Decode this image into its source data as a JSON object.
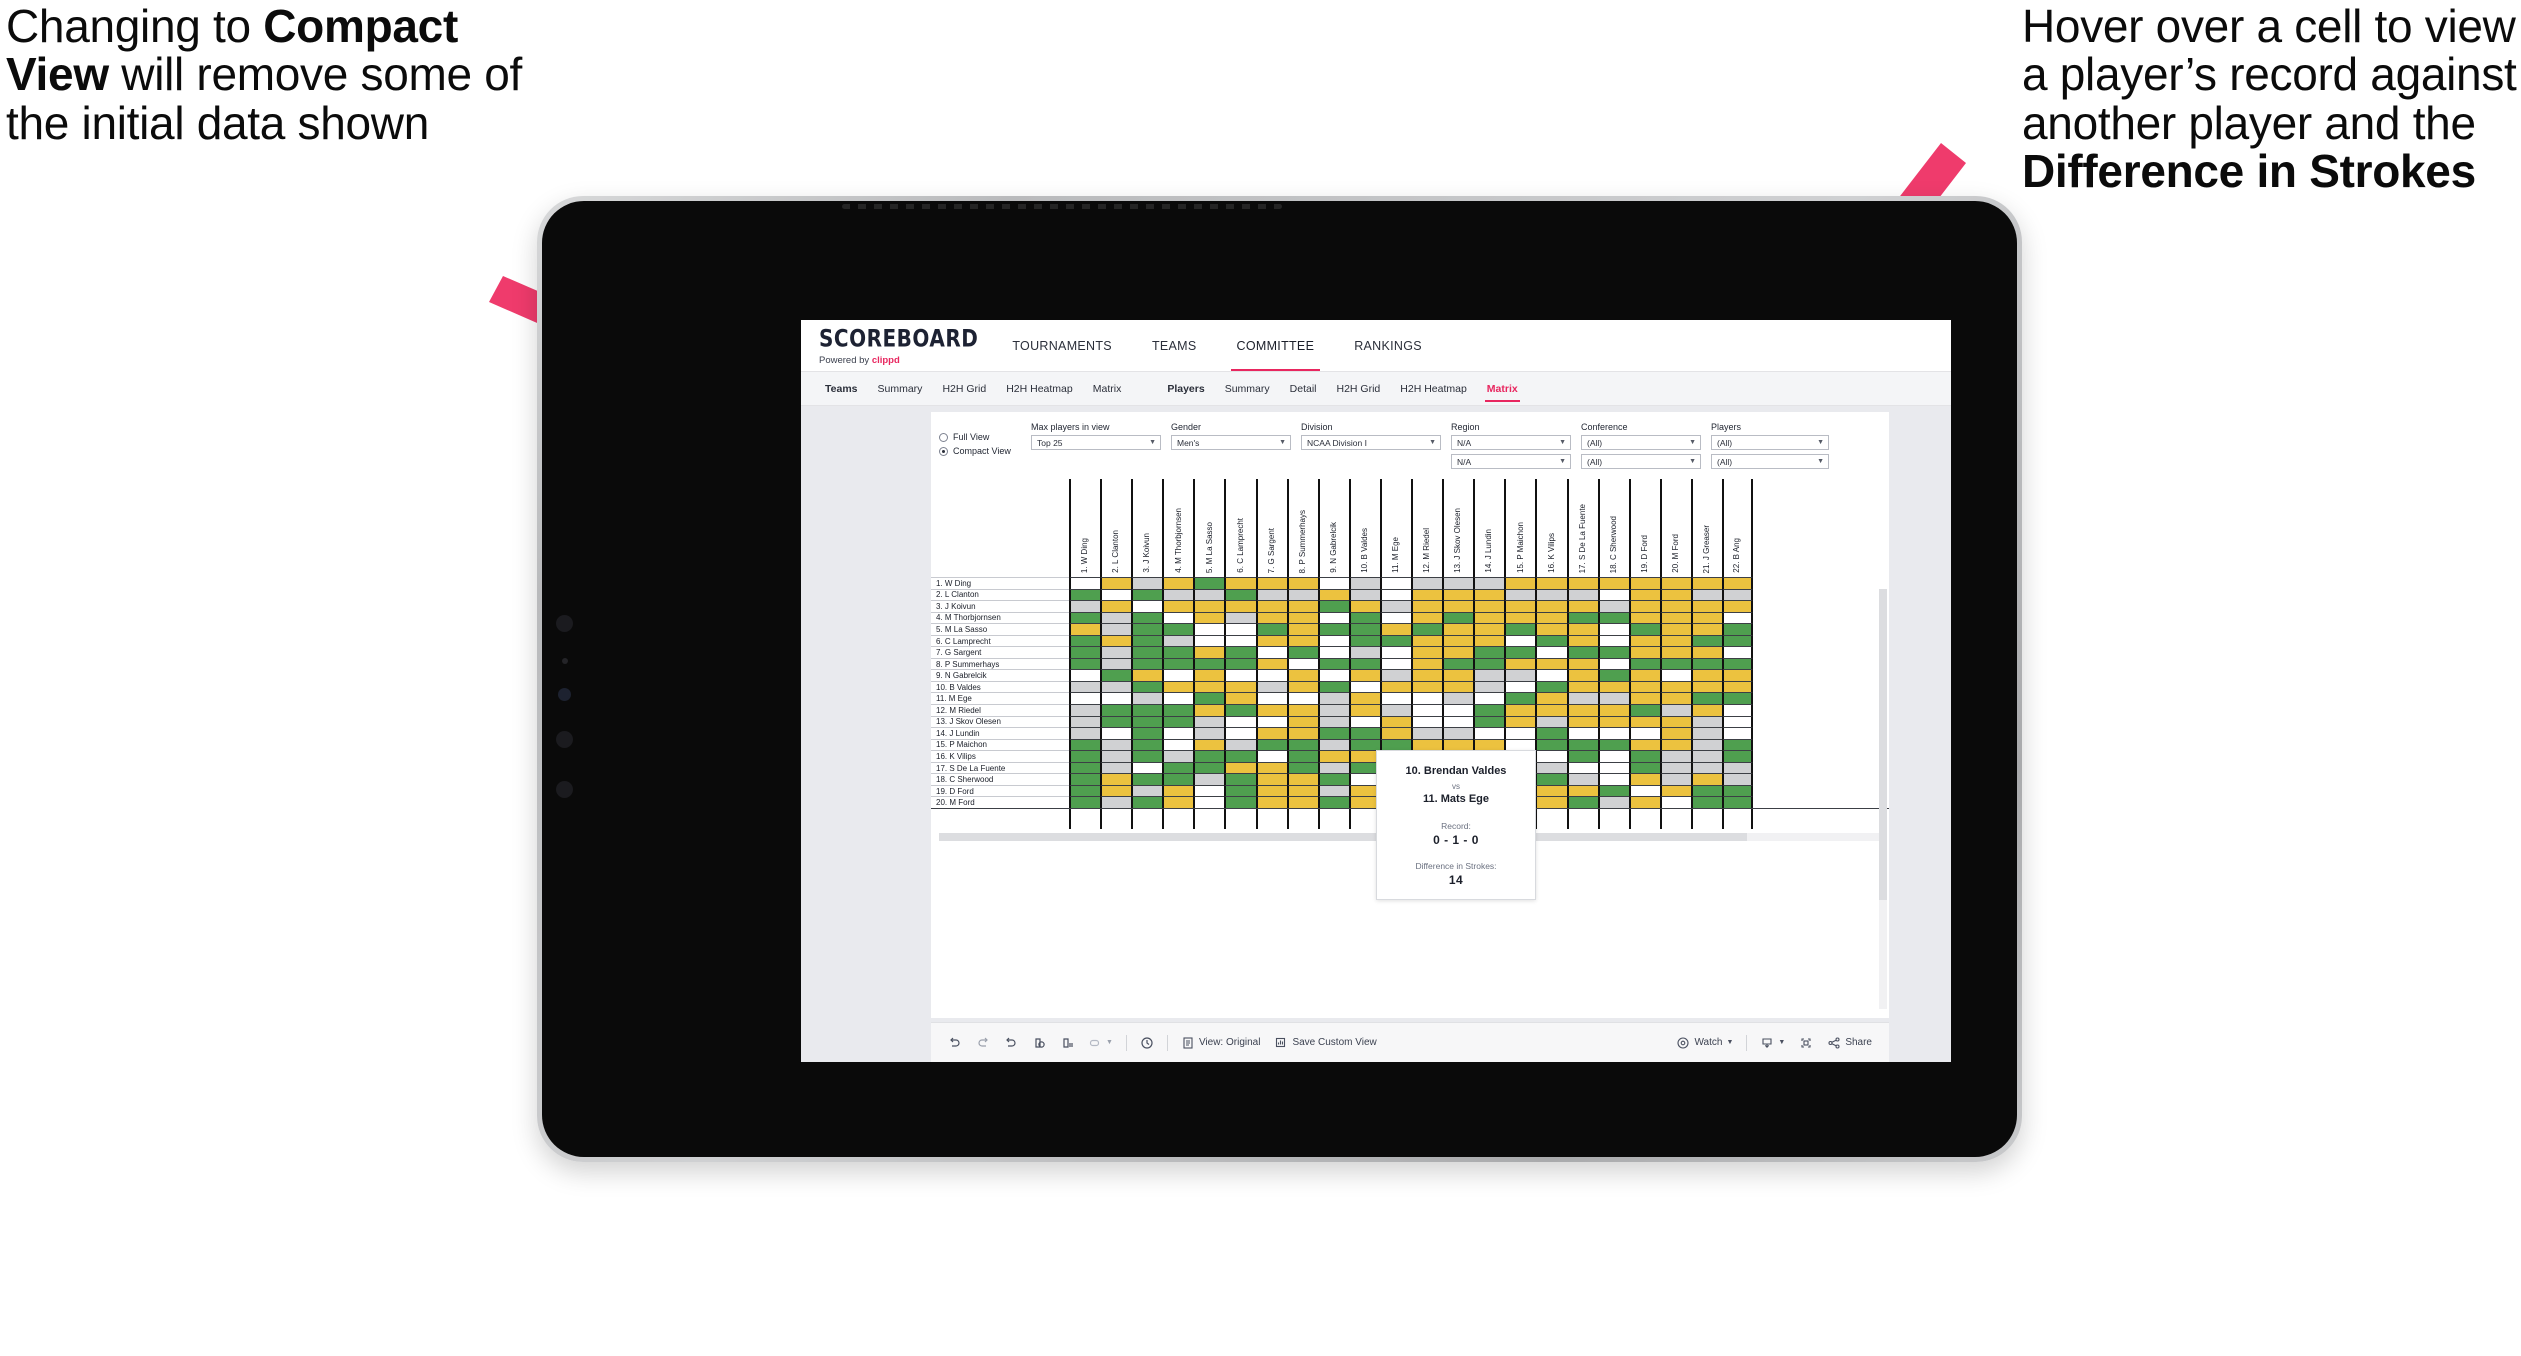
{
  "annotations": {
    "left": {
      "line1": "Changing to",
      "bold1": "Compact View",
      "line2": " will remove some of the initial data shown"
    },
    "right": {
      "line1": "Hover over a cell to view a player’s record against another player and the ",
      "bold1": "Difference in Strokes"
    },
    "arrow_color": "#ef3b6c"
  },
  "app": {
    "brand": {
      "name": "SCOREBOARD",
      "sub_prefix": "Powered by ",
      "sub_brand": "clippd"
    },
    "top_tabs": [
      {
        "label": "TOURNAMENTS",
        "active": false
      },
      {
        "label": "TEAMS",
        "active": false
      },
      {
        "label": "COMMITTEE",
        "active": true
      },
      {
        "label": "RANKINGS",
        "active": false
      }
    ],
    "sub_nav": {
      "group_teams": {
        "head": "Teams",
        "items": [
          "Summary",
          "H2H Grid",
          "H2H Heatmap",
          "Matrix"
        ]
      },
      "group_players": {
        "head": "Players",
        "items": [
          "Summary",
          "Detail",
          "H2H Grid",
          "H2H Heatmap",
          "Matrix"
        ],
        "active": "Matrix"
      }
    },
    "filters": {
      "view_options": [
        {
          "label": "Full View",
          "selected": false
        },
        {
          "label": "Compact View",
          "selected": true
        }
      ],
      "selects": [
        {
          "label": "Max players in view",
          "value": "Top 25"
        },
        {
          "label": "Gender",
          "value": "Men's"
        },
        {
          "label": "Division",
          "value": "NCAA Division I"
        },
        {
          "label": "Region",
          "value": "N/A",
          "value2": "N/A"
        },
        {
          "label": "Conference",
          "value": "(All)",
          "value2": "(All)"
        },
        {
          "label": "Players",
          "value": "(All)",
          "value2": "(All)"
        }
      ]
    },
    "tooltip": {
      "player_a": "10. Brendan Valdes",
      "vs": "vs",
      "player_b": "11. Mats Ege",
      "record_label": "Record:",
      "record_value": "0 - 1 - 0",
      "strokes_label": "Difference in Strokes:",
      "strokes_value": "14"
    },
    "bottom_toolbar": {
      "icons_left": [
        "undo-icon",
        "redo-icon",
        "revert-icon",
        "refresh-data-icon",
        "pause-refresh-icon",
        "keep-shape-icon",
        "chevron-down-icon"
      ],
      "clock_icon": "history-icon",
      "view_original": "View: Original",
      "view_original_icon": "view-original-icon",
      "save_custom_view": "Save Custom View",
      "save_custom_view_icon": "save-view-icon",
      "watch": "Watch",
      "watch_icon": "eye-icon",
      "download_icon": "download-icon",
      "fullscreen_icon": "fullscreen-icon",
      "share": "Share",
      "share_icon": "share-icon"
    }
  },
  "chart_data": {
    "type": "heatmap",
    "title": "Head-to-head player matrix",
    "legend": {
      "win": "#4f9f4f",
      "loss": "#ecc23f",
      "tie": "#d0d1d3",
      "none": "#ffffff"
    },
    "colors": {
      "green": "#4f9f4f",
      "yellow": "#ecc23f",
      "grey": "#d0d1d3",
      "white": "#ffffff"
    },
    "columns": [
      "1. W Ding",
      "2. L Clanton",
      "3. J Koivun",
      "4. M Thorbjornsen",
      "5. M La Sasso",
      "6. C Lamprecht",
      "7. G Sargent",
      "8. P Summerhays",
      "9. N Gabrelcik",
      "10. B Valdes",
      "11. M Ege",
      "12. M Riedel",
      "13. J Skov Olesen",
      "14. J Lundin",
      "15. P Maichon",
      "16. K Vilips",
      "17. S De La Fuente",
      "18. C Sherwood",
      "19. D Ford",
      "20. M Ford",
      "21. J Greaser",
      "22. B Ang"
    ],
    "rows": [
      "1. W Ding",
      "2. L Clanton",
      "3. J Koivun",
      "4. M Thorbjornsen",
      "5. M La Sasso",
      "6. C Lamprecht",
      "7. G Sargent",
      "8. P Summerhays",
      "9. N Gabrelcik",
      "10. B Valdes",
      "11. M Ege",
      "12. M Riedel",
      "13. J Skov Olesen",
      "14. J Lundin",
      "15. P Maichon",
      "16. K Vilips",
      "17. S De La Fuente",
      "18. C Sherwood",
      "19. D Ford",
      "20. M Ford"
    ],
    "cells": [
      [
        "w",
        "y",
        "g",
        "y",
        "n",
        "y",
        "y",
        "y",
        "w",
        "g",
        "w",
        "g",
        "g",
        "g",
        "y",
        "y",
        "y",
        "y",
        "y",
        "y",
        "y",
        "y"
      ],
      [
        "n",
        "w",
        "n",
        "g",
        "g",
        "n",
        "g",
        "g",
        "y",
        "g",
        "w",
        "y",
        "y",
        "y",
        "g",
        "g",
        "g",
        "w",
        "y",
        "y",
        "g",
        "g"
      ],
      [
        "g",
        "y",
        "w",
        "y",
        "y",
        "y",
        "y",
        "y",
        "n",
        "y",
        "g",
        "y",
        "y",
        "y",
        "y",
        "y",
        "y",
        "g",
        "y",
        "y",
        "y",
        "y"
      ],
      [
        "n",
        "g",
        "n",
        "w",
        "y",
        "g",
        "y",
        "y",
        "w",
        "n",
        "w",
        "y",
        "n",
        "y",
        "y",
        "y",
        "n",
        "n",
        "y",
        "y",
        "y",
        "w"
      ],
      [
        "y",
        "g",
        "n",
        "n",
        "w",
        "w",
        "n",
        "y",
        "n",
        "n",
        "y",
        "n",
        "y",
        "y",
        "n",
        "y",
        "y",
        "w",
        "n",
        "y",
        "y",
        "n"
      ],
      [
        "n",
        "y",
        "n",
        "g",
        "w",
        "w",
        "y",
        "y",
        "w",
        "n",
        "n",
        "y",
        "y",
        "y",
        "w",
        "n",
        "y",
        "w",
        "y",
        "y",
        "n",
        "n"
      ],
      [
        "n",
        "g",
        "n",
        "n",
        "y",
        "n",
        "w",
        "n",
        "w",
        "g",
        "w",
        "y",
        "y",
        "n",
        "n",
        "w",
        "n",
        "n",
        "y",
        "y",
        "y",
        "w"
      ],
      [
        "n",
        "g",
        "n",
        "n",
        "n",
        "n",
        "y",
        "w",
        "n",
        "n",
        "w",
        "y",
        "n",
        "n",
        "y",
        "y",
        "y",
        "w",
        "n",
        "n",
        "n",
        "n"
      ],
      [
        "w",
        "n",
        "y",
        "w",
        "y",
        "w",
        "w",
        "y",
        "w",
        "y",
        "g",
        "y",
        "y",
        "g",
        "g",
        "w",
        "y",
        "n",
        "y",
        "w",
        "y",
        "y"
      ],
      [
        "g",
        "g",
        "n",
        "y",
        "y",
        "y",
        "g",
        "y",
        "n",
        "w",
        "y",
        "y",
        "y",
        "g",
        "w",
        "n",
        "y",
        "y",
        "y",
        "y",
        "y",
        "y"
      ],
      [
        "w",
        "w",
        "g",
        "w",
        "n",
        "y",
        "w",
        "w",
        "g",
        "y",
        "w",
        "w",
        "g",
        "w",
        "n",
        "y",
        "g",
        "g",
        "y",
        "y",
        "n",
        "n"
      ],
      [
        "g",
        "n",
        "n",
        "n",
        "y",
        "n",
        "y",
        "y",
        "g",
        "y",
        "g",
        "w",
        "w",
        "n",
        "y",
        "y",
        "y",
        "y",
        "n",
        "g",
        "y",
        "w"
      ],
      [
        "g",
        "n",
        "n",
        "n",
        "g",
        "w",
        "w",
        "y",
        "g",
        "w",
        "y",
        "w",
        "w",
        "n",
        "y",
        "g",
        "y",
        "y",
        "y",
        "y",
        "g",
        "w"
      ],
      [
        "g",
        "w",
        "n",
        "w",
        "g",
        "w",
        "y",
        "y",
        "n",
        "n",
        "y",
        "g",
        "g",
        "w",
        "w",
        "n",
        "w",
        "w",
        "w",
        "y",
        "g",
        "w"
      ],
      [
        "n",
        "g",
        "n",
        "w",
        "y",
        "g",
        "n",
        "n",
        "g",
        "n",
        "n",
        "y",
        "y",
        "y",
        "w",
        "n",
        "n",
        "n",
        "y",
        "y",
        "g",
        "n"
      ],
      [
        "n",
        "g",
        "n",
        "g",
        "n",
        "n",
        "w",
        "n",
        "y",
        "y",
        "y",
        "n",
        "y",
        "n",
        "g",
        "w",
        "n",
        "w",
        "n",
        "g",
        "g",
        "n"
      ],
      [
        "n",
        "g",
        "w",
        "n",
        "n",
        "y",
        "y",
        "n",
        "g",
        "n",
        "y",
        "n",
        "n",
        "y",
        "y",
        "g",
        "w",
        "w",
        "n",
        "g",
        "g",
        "g"
      ],
      [
        "n",
        "y",
        "n",
        "n",
        "g",
        "n",
        "y",
        "y",
        "n",
        "w",
        "y",
        "n",
        "n",
        "n",
        "y",
        "n",
        "g",
        "w",
        "y",
        "g",
        "y",
        "g"
      ],
      [
        "n",
        "y",
        "g",
        "y",
        "w",
        "n",
        "y",
        "y",
        "g",
        "y",
        "n",
        "w",
        "y",
        "y",
        "y",
        "y",
        "y",
        "n",
        "w",
        "y",
        "n",
        "n"
      ],
      [
        "n",
        "g",
        "n",
        "y",
        "w",
        "n",
        "y",
        "y",
        "n",
        "y",
        "w",
        "g",
        "y",
        "g",
        "n",
        "y",
        "n",
        "g",
        "y",
        "w",
        "n",
        "n"
      ]
    ]
  }
}
